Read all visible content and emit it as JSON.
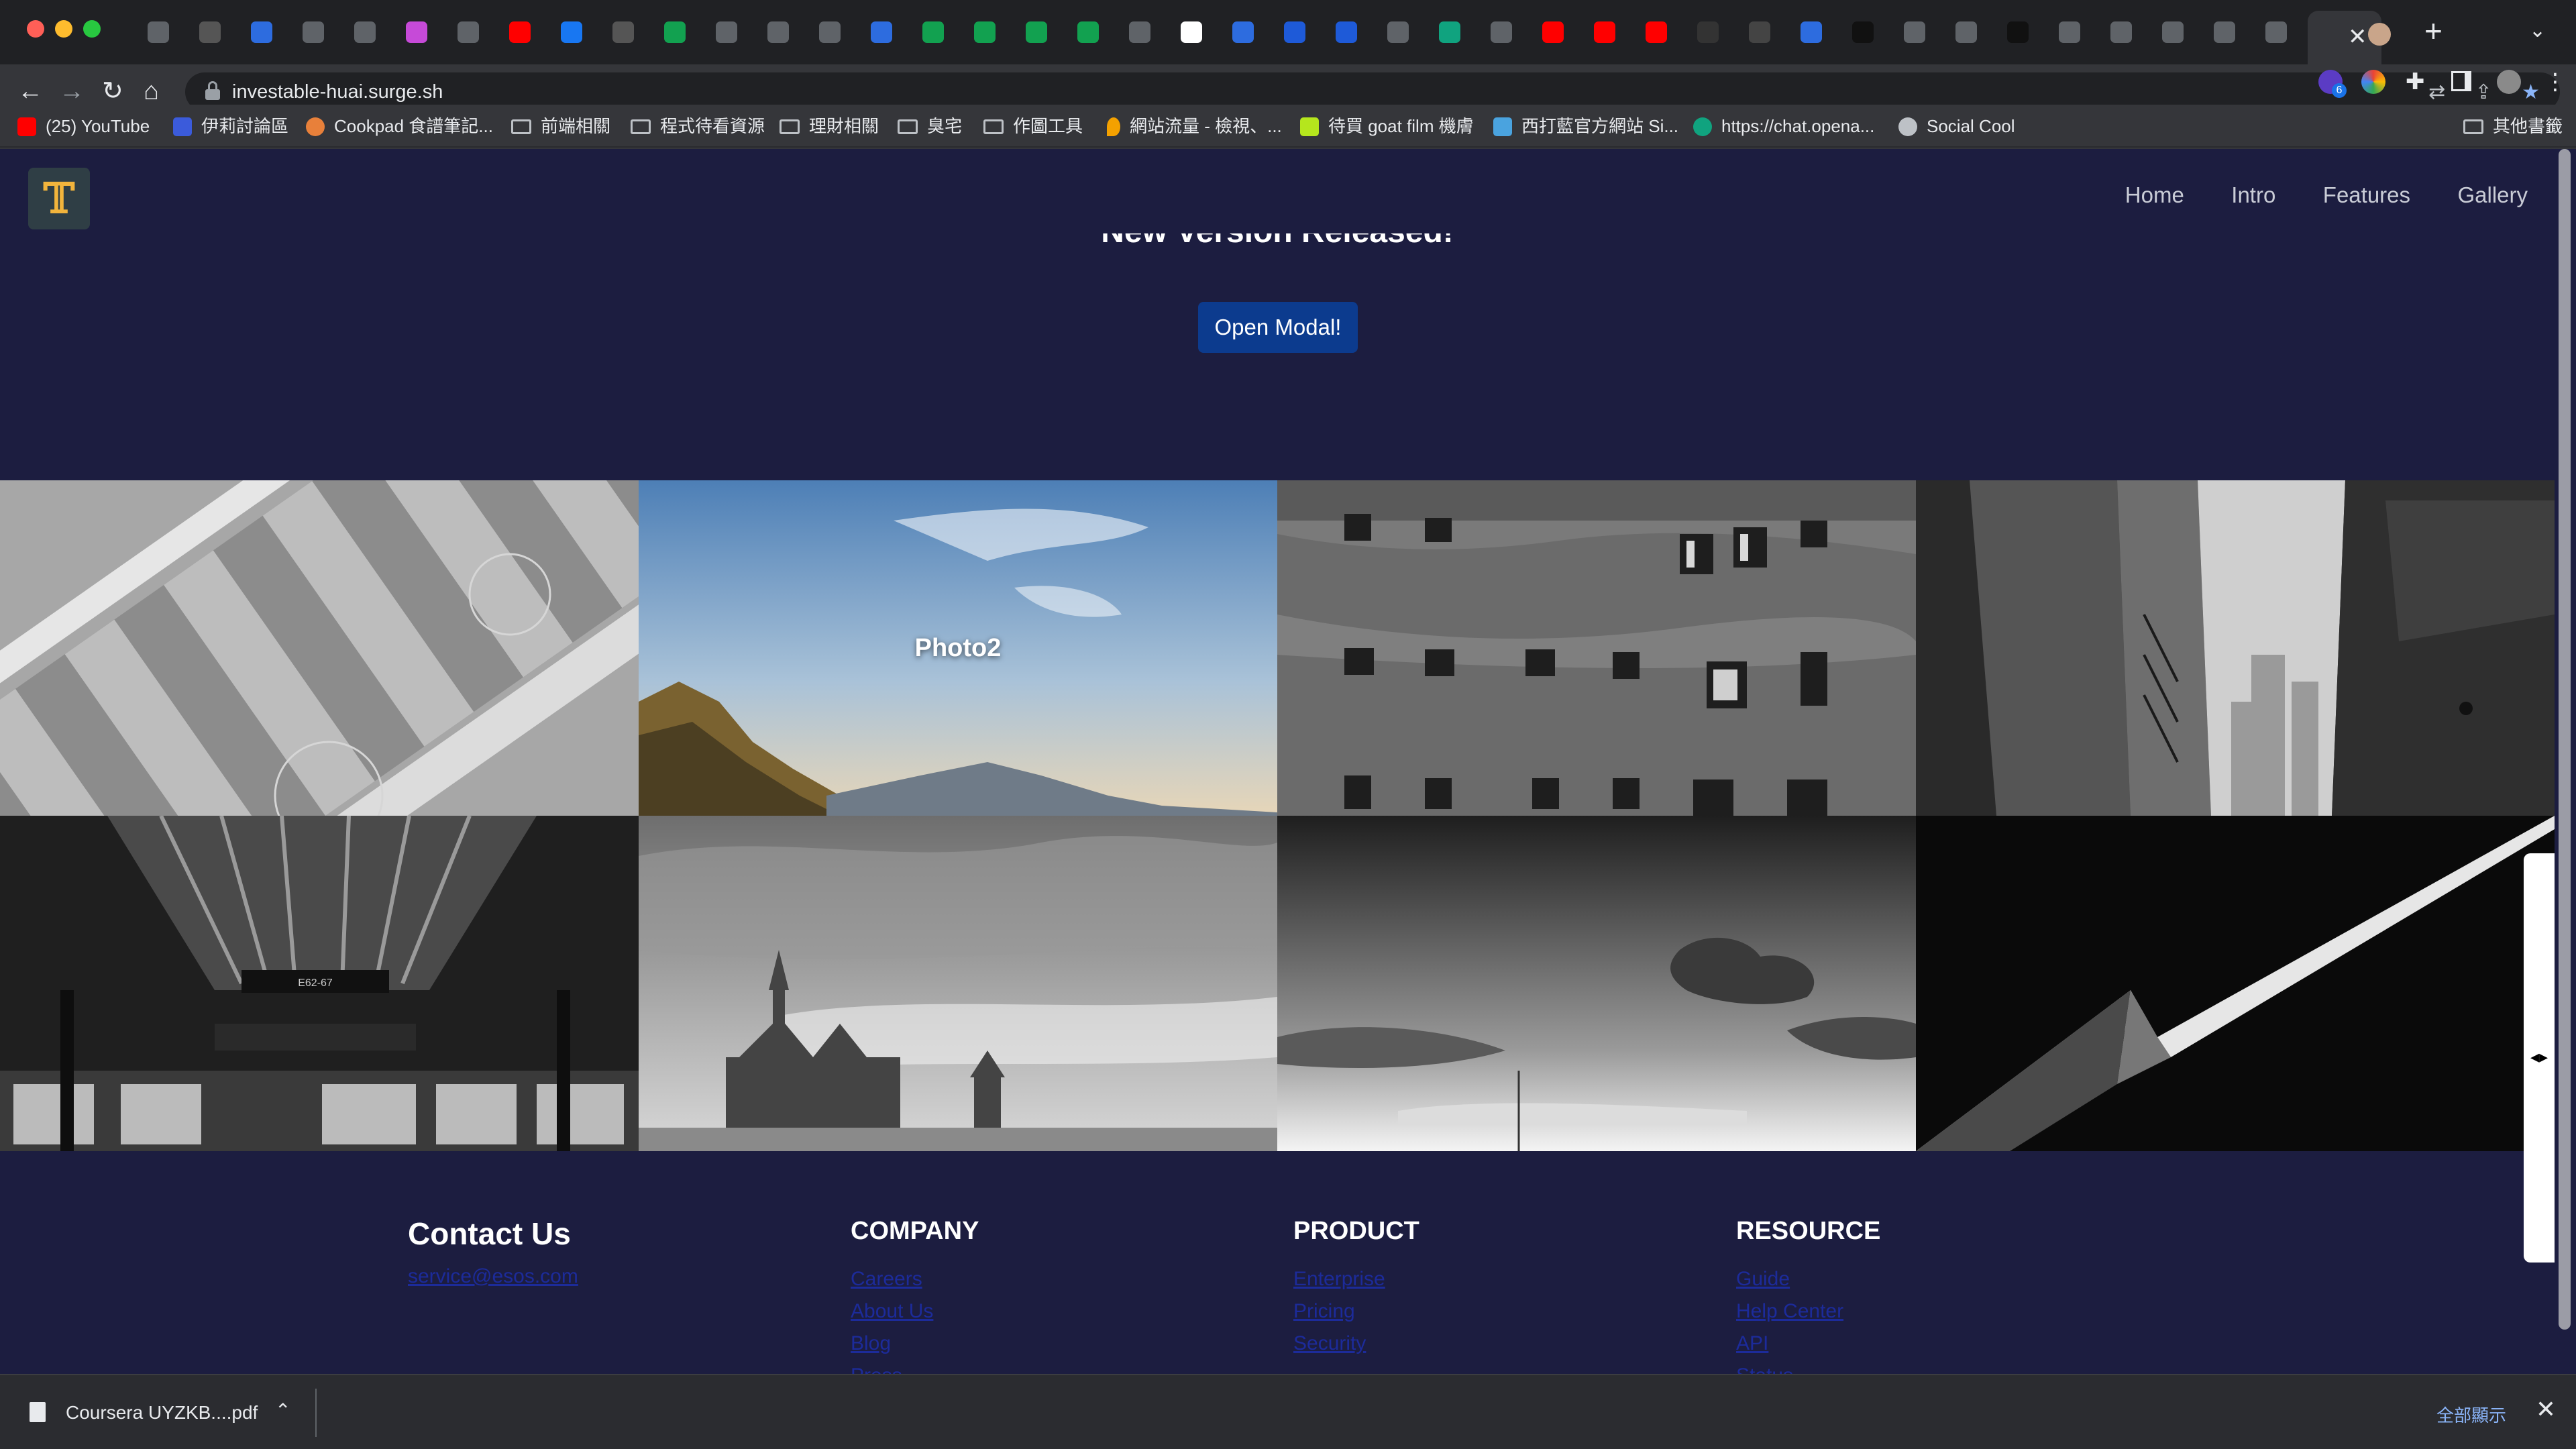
{
  "browser": {
    "tab_favicons": [
      "layers-icon",
      "github-icon",
      "puzzle-icon",
      "doc-icon",
      "circle-icon",
      "star-icon",
      "dots-icon",
      "youtube-icon",
      "facebook-icon",
      "github-icon",
      "c-icon",
      "globe-icon",
      "k-icon",
      "doc-icon",
      "heart-icon",
      "c-icon",
      "c-icon",
      "c-icon",
      "c-icon",
      "shield-icon",
      "google-icon",
      "puzzle-icon",
      "b-icon",
      "b-icon",
      "g-icon",
      "gpt-icon",
      "v-icon",
      "youtube-icon",
      "youtube-icon",
      "youtube-icon",
      "z-icon",
      "imdb-icon",
      "puzzle-icon",
      "triangle-icon",
      "slope-icon",
      "doc-icon",
      "medium-icon",
      "mbt-icon",
      "globe-icon",
      "globe-icon",
      "globe-icon",
      "shield-icon"
    ],
    "active_tab_close": "✕",
    "new_tab": "+",
    "url": "investable-huai.surge.sh",
    "extension_badge": "6"
  },
  "bookmarks": {
    "items": [
      {
        "label": "(25) YouTube",
        "icon": "youtube-icon",
        "color": "#ff0000"
      },
      {
        "label": "伊莉討論區",
        "icon": "doc-icon",
        "color": "#3b5bdb"
      },
      {
        "label": "Cookpad 食譜筆記...",
        "icon": "cookpad-icon",
        "color": "#e8803a"
      },
      {
        "label": "前端相關",
        "icon": "folder-icon"
      },
      {
        "label": "程式待看資源",
        "icon": "folder-icon"
      },
      {
        "label": "理財相關",
        "icon": "folder-icon"
      },
      {
        "label": "臭宅",
        "icon": "folder-icon"
      },
      {
        "label": "作圖工具",
        "icon": "folder-icon"
      },
      {
        "label": "網站流量 - 檢視、...",
        "icon": "pin-icon",
        "color": "#f4a100"
      },
      {
        "label": "待買 goat film 機膚",
        "icon": "goat-icon",
        "color": "#b5e61d"
      },
      {
        "label": "西打藍官方網站 Si...",
        "icon": "site-icon",
        "color": "#4aa3df"
      },
      {
        "label": "https://chat.opena...",
        "icon": "gpt-icon",
        "color": "#10a37f"
      },
      {
        "label": "Social Cool",
        "icon": "globe-icon",
        "color": "#bdc1c6"
      }
    ],
    "other": "其他書籤"
  },
  "page": {
    "nav": [
      "Home",
      "Intro",
      "Features",
      "Gallery"
    ],
    "hero_title": "New Version Released!",
    "modal_button": "Open Modal!",
    "gallery_label": "Photo2"
  },
  "footer": {
    "contact_title": "Contact Us",
    "contact_email": "service@esos.com",
    "columns": [
      {
        "title": "COMPANY",
        "links": [
          "Careers",
          "About Us",
          "Blog",
          "Press"
        ]
      },
      {
        "title": "PRODUCT",
        "links": [
          "Enterprise",
          "Pricing",
          "Security"
        ]
      },
      {
        "title": "RESOURCE",
        "links": [
          "Guide",
          "Help Center",
          "API",
          "Status"
        ]
      }
    ]
  },
  "downloads": {
    "file": "Coursera UYZKB....pdf",
    "show_all": "全部顯示"
  },
  "colors": {
    "page_bg": "#1c1d40",
    "button_bg": "#0c3b8e",
    "link": "#1c2b9a"
  }
}
